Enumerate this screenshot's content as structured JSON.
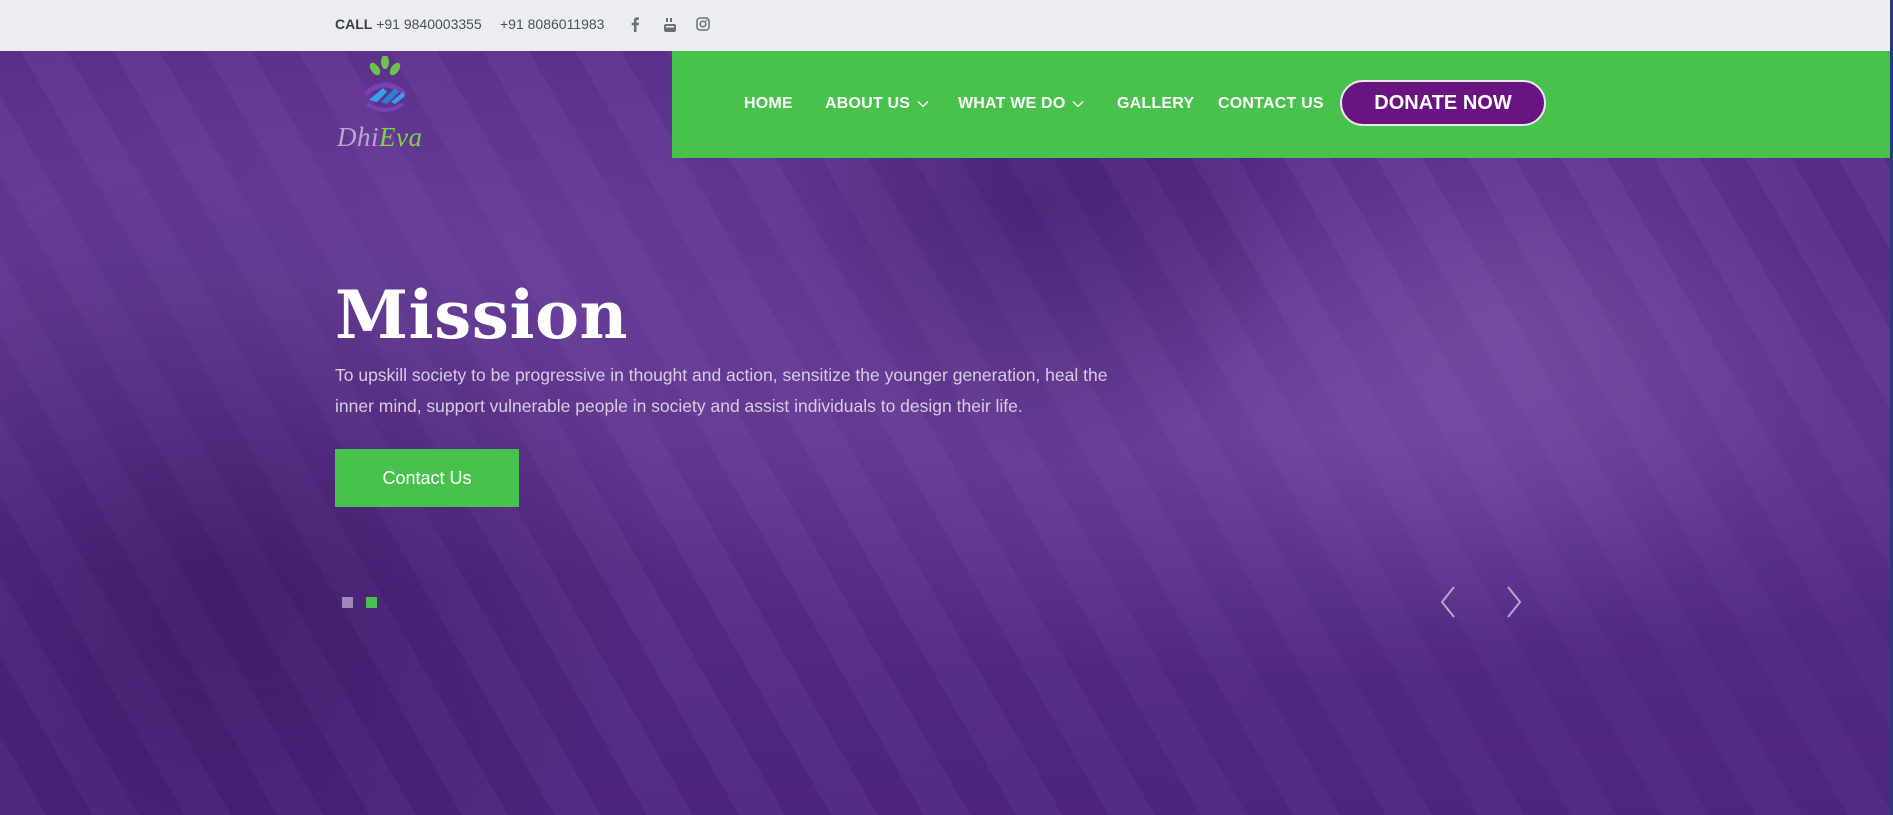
{
  "topbar": {
    "call_label": "CALL",
    "phone_primary": "+91 9840003355",
    "phone_secondary": "+91 8086011983",
    "social_icons": [
      "facebook-icon",
      "youtube-icon",
      "instagram-icon"
    ]
  },
  "logo": {
    "word_part1": "Dhi",
    "word_part2": "Eva"
  },
  "nav": {
    "items": [
      {
        "label": "HOME",
        "dropdown": false
      },
      {
        "label": "ABOUT US",
        "dropdown": true
      },
      {
        "label": "WHAT WE DO",
        "dropdown": true
      },
      {
        "label": "GALLERY",
        "dropdown": false
      },
      {
        "label": "CONTACT US",
        "dropdown": false
      }
    ],
    "donate_label": "DONATE NOW"
  },
  "hero": {
    "title": "Mission",
    "description": "To upskill society to be progressive in thought and action, sensitize the younger generation, heal the inner mind, support vulnerable people in society and assist individuals to design their life.",
    "cta_label": "Contact Us",
    "slides_total": 2,
    "active_slide": 2
  },
  "colors": {
    "nav_green": "#48c24d",
    "donate_purple": "#6a1482",
    "hero_overlay": "#5a2f86",
    "topbar_bg": "#ecedf0"
  }
}
